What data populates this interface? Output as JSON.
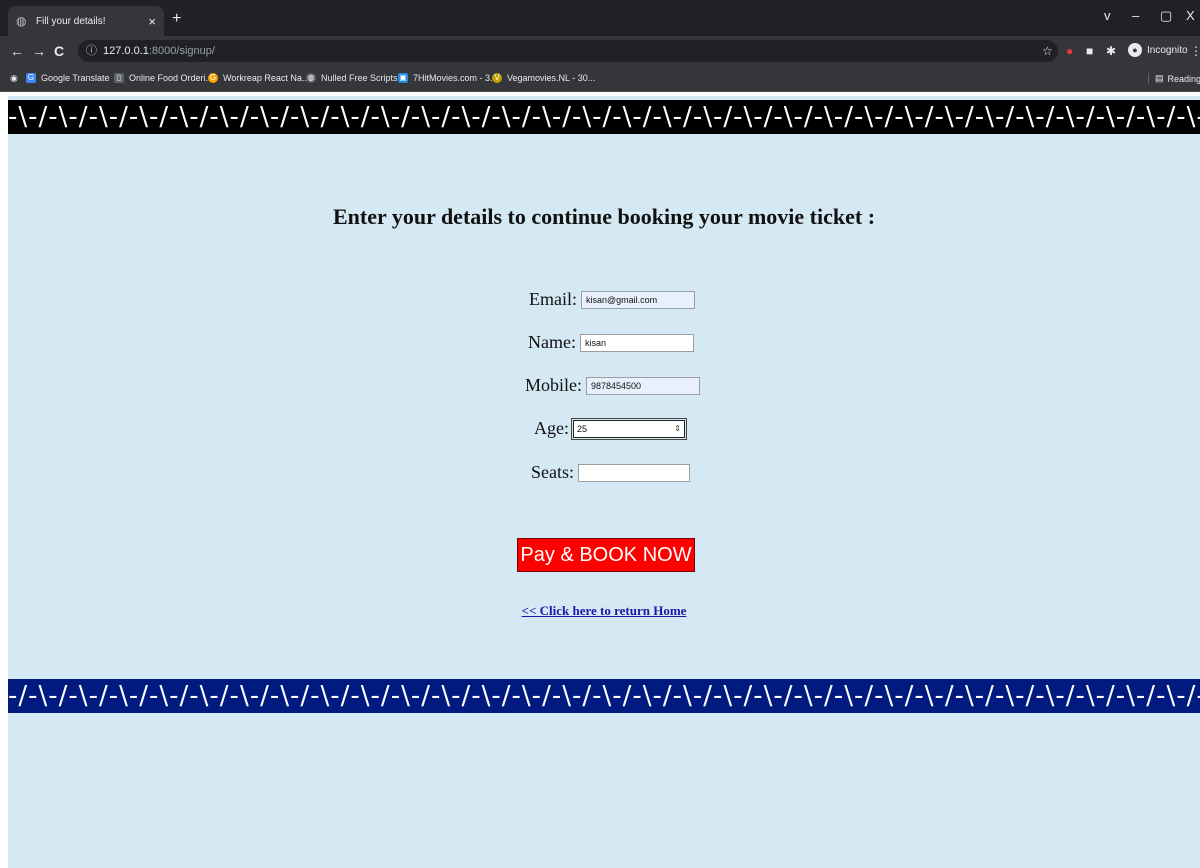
{
  "browser": {
    "tab_title": "Fill your details!",
    "tab_close": "×",
    "new_tab": "+",
    "url_host": "127.0.0.1",
    "url_rest": ":8000/signup/",
    "incognito_label": "Incognito",
    "window_controls": [
      "v",
      "–",
      "▢",
      "X"
    ],
    "bookmarks": [
      {
        "label": "Google Translate",
        "icon": "translate-icon"
      },
      {
        "label": "Online Food Orderi...",
        "icon": "bookmark-icon"
      },
      {
        "label": "Workreap React Na...",
        "icon": "bookmark-icon"
      },
      {
        "label": "Nulled Free Scripts...",
        "icon": "globe-icon"
      },
      {
        "label": "7HitMovies.com - 3...",
        "icon": "bookmark-icon"
      },
      {
        "label": "Vegamovies.NL - 30...",
        "icon": "bookmark-icon"
      }
    ],
    "reading_list": "Reading list"
  },
  "page": {
    "marquee_top": "-\\-/-\\-/-\\-/-\\-/-\\-/-\\-/-\\-/-\\-/-\\-/-\\-/-\\-/-\\-/-\\-/-\\-/-\\-/-\\-/-\\-/-\\-/-\\-/-\\-/-\\-/-\\-/-\\-/-\\-/-\\-/-\\-/-\\-/-\\-/-\\-/-\\-/-\\-/-\\-/-\\-/-\\-/-\\-/-\\-",
    "marquee_bottom": "-/-\\-/-\\-/-\\-/-\\-/-\\-/-\\-/-\\-/-\\-/-\\-/-\\-/-\\-/-\\-/-\\-/-\\-/-\\-/-\\-/-\\-/-\\-/-\\-/-\\-/-\\-/-\\-/-\\-/-\\-/-\\-/-\\-/-\\-/-\\-/-\\-/-\\-/-\\-/-\\-/-\\-/-\\-/-\\-/-",
    "heading": "Enter your details to continue booking your movie ticket :",
    "form": {
      "email_label": "Email:",
      "email_value": "kisan@gmail.com",
      "name_label": "Name:",
      "name_value": "kisan",
      "mobile_label": "Mobile:",
      "mobile_value": "9878454500",
      "age_label": "Age:",
      "age_value": "25",
      "seats_label": "Seats:",
      "seats_value": ""
    },
    "pay_button": "Pay & BOOK NOW",
    "home_link": "<< Click here to return Home"
  },
  "colors": {
    "page_bg": "#d4e9f4",
    "pay_button": "#ff0000",
    "marquee_top_bg": "#000000",
    "marquee_bottom_bg": "#001a80",
    "link": "#1a1aa6"
  }
}
